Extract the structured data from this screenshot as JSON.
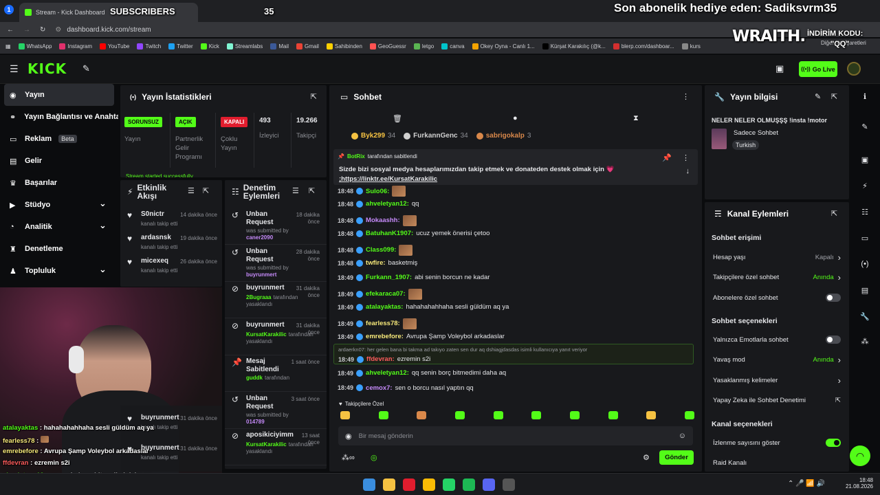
{
  "browser": {
    "tab_title": "Stream - Kick Dashboard",
    "url": "dashboard.kick.com/stream",
    "bookmarks": [
      "WhatsApp",
      "Instagram",
      "YouTube",
      "Twitch",
      "Twitter",
      "Kick",
      "Streamlabs",
      "Mail",
      "Gmail",
      "Sahibinden",
      "GeoGuessr",
      "letgo",
      "canva",
      "Okey Oyna - Canlı 1...",
      "Kürşat Karakılıç (@k...",
      "blerp.com/dashboar...",
      "kurs"
    ],
    "other_bookmarks": "Diğer Yer İşaretleri"
  },
  "overlay": {
    "subscribers_label": "SUBSCRIBERS",
    "subscribers_count": "35",
    "last_gift": "Son abonelik hediye eden: Sadiksvrm35",
    "sponsor": "WRAITH.",
    "discount_label": "İNDİRİM KODU:",
    "discount_code": "\"QQ\""
  },
  "topnav": {
    "go_live": "Go Live"
  },
  "sidebar": {
    "items": [
      {
        "label": "Yayın",
        "icon": "broadcast-icon"
      },
      {
        "label": "Yayın Bağlantısı ve Anahtarı",
        "icon": "link-icon"
      },
      {
        "label": "Reklam",
        "icon": "ad-icon",
        "badge": "Beta"
      },
      {
        "label": "Gelir",
        "icon": "wallet-icon"
      },
      {
        "label": "Başarılar",
        "icon": "trophy-icon"
      },
      {
        "label": "Stüdyo",
        "icon": "studio-icon"
      },
      {
        "label": "Analitik",
        "icon": "chart-icon"
      },
      {
        "label": "Denetleme",
        "icon": "shield-icon"
      },
      {
        "label": "Topluluk",
        "icon": "community-icon"
      }
    ]
  },
  "stats": {
    "title": "Yayın İstatistikleri",
    "items": [
      {
        "badge": "SORUNSUZ",
        "label": "Yayın"
      },
      {
        "badge": "AÇIK",
        "label": "Partnerlik Gelir Programı"
      },
      {
        "badge": "KAPALI",
        "label": "Çoklu Yayın"
      },
      {
        "value": "493",
        "label": "İzleyici"
      },
      {
        "value": "19.266",
        "label": "Takipçi"
      }
    ],
    "status_msg": "Stream started successfully"
  },
  "activity": {
    "title": "Etkinlik Akışı",
    "items": [
      {
        "user": "S0nictr",
        "action": "kanalı takip etti",
        "time": "14 dakika önce"
      },
      {
        "user": "ardasnsk",
        "action": "kanalı takip etti",
        "time": "19 dakika önce"
      },
      {
        "user": "micexeq",
        "action": "kanalı takip etti",
        "time": "26 dakika önce"
      },
      {
        "user": "buyrunmert",
        "action": "kanalı takip etti",
        "time": "31 dakika önce"
      },
      {
        "user": "buyrunmert",
        "action": "kanalı takip etti",
        "time": "31 dakika önce"
      }
    ]
  },
  "moderation": {
    "title": "Denetim Eylemleri",
    "items": [
      {
        "title": "Unban Request",
        "sub": "was submitted by",
        "who": "caner2090",
        "time": "18 dakika önce"
      },
      {
        "title": "Unban Request",
        "sub": "was submitted by",
        "who": "buyrunmert",
        "time": "28 dakika önce"
      },
      {
        "title": "buyrunmert",
        "who": "2Bugraaa",
        "sub": "tarafından yasaklandı",
        "time": "31 dakika önce"
      },
      {
        "title": "buyrunmert",
        "who": "KursatKarakilic",
        "sub": "tarafından yasaklandı",
        "time": "31 dakika önce"
      },
      {
        "title": "Mesaj Sabitlendi",
        "who": "guddk",
        "sub": "tarafından",
        "time": "1 saat önce"
      },
      {
        "title": "Unban Request",
        "sub": "was submitted by",
        "who": "014789",
        "time": "3 saat önce"
      },
      {
        "title": "aposikiciyimm",
        "who": "KursatKarakilic",
        "sub": "tarafından yasaklandı",
        "time": "13 saat önce"
      }
    ]
  },
  "chat": {
    "title": "Sohbet",
    "top_gifters": [
      {
        "name": "Byk299",
        "count": "34"
      },
      {
        "name": "FurkannGenc",
        "count": "34"
      },
      {
        "name": "sabrigokalp",
        "count": "3"
      }
    ],
    "pinned": {
      "user": "BotRix",
      "note": "tarafından sabitlendi",
      "text": "Sizde bizi sosyal medya hesaplarımızdan takip etmek ve donateden destek olmak için 💗",
      "link": ";https://linktr.ee/KursatKarakilic"
    },
    "messages": [
      {
        "t": "18:48",
        "user": "Sulo06:",
        "color": "#53fc18",
        "text": "",
        "emote": true
      },
      {
        "t": "18:48",
        "user": "ahveletyan12:",
        "color": "#53fc18",
        "text": "qq"
      },
      {
        "t": "18:48",
        "user": "Mokaashh:",
        "color": "#c58af9",
        "text": "",
        "emote": true
      },
      {
        "t": "18:48",
        "user": "BatuhanK1907:",
        "color": "#53fc18",
        "text": "ucuz yemek önerisi çetoo"
      },
      {
        "t": "18:48",
        "user": "Class099:",
        "color": "#53fc18",
        "text": "",
        "emote": true
      },
      {
        "t": "18:48",
        "user": "twfire:",
        "color": "#f7e97a",
        "text": "basketmiş"
      },
      {
        "t": "18:49",
        "user": "Furkann_1907:",
        "color": "#53fc18",
        "text": "abi senin borcun ne kadar"
      },
      {
        "t": "18:49",
        "user": "efekaraca07:",
        "color": "#53fc18",
        "text": "",
        "emote": true
      },
      {
        "t": "18:49",
        "user": "atalayaktas:",
        "color": "#53fc18",
        "text": "hahahahahhaha sesli güldüm aq ya"
      },
      {
        "t": "18:49",
        "user": "fearless78:",
        "color": "#f7e97a",
        "text": "",
        "emote": true
      },
      {
        "t": "18:49",
        "user": "emrebefore:",
        "color": "#f7e97a",
        "text": "Avrupa Şamp Voleybol arkadaslar"
      }
    ],
    "reply": {
      "context": "ardaerkn07: her gelen bana bi takma ad takıyo zaten sen dur aq dshiagjdasdas isimli kullanıcıya yanıt veriyor",
      "t": "18:49",
      "user": "ffdevran:",
      "text": "ezremin s2i"
    },
    "messages2": [
      {
        "t": "18:49",
        "user": "ahveletyan12:",
        "color": "#53fc18",
        "text": "qq senin borç bitmedimi daha aq"
      },
      {
        "t": "18:49",
        "user": "cemox7:",
        "color": "#c58af9",
        "text": "sen o borcu nasıl yaptın qq"
      }
    ],
    "followers_only": "Takipçilere Özel",
    "input_placeholder": "Bir mesaj gönderin",
    "send": "Gönder"
  },
  "info": {
    "title": "Yayın bilgisi",
    "stream_title": "NELER NELER OLMUŞŞŞ !insta !motor",
    "category": "Sadece Sohbet",
    "language": "Turkish"
  },
  "actions": {
    "title": "Kanal Eylemleri",
    "chat_access": "Sohbet erişimi",
    "rows1": [
      {
        "label": "Hesap yaşı",
        "value": "Kapalı",
        "type": "chevron"
      },
      {
        "label": "Takipçilere özel sohbet",
        "value": "Anında",
        "type": "chevron",
        "green": true
      },
      {
        "label": "Abonelere özel sohbet",
        "type": "toggle",
        "on": false
      }
    ],
    "chat_options": "Sohbet seçenekleri",
    "rows2": [
      {
        "label": "Yalnızca Emotlarla sohbet",
        "type": "toggle",
        "on": false
      },
      {
        "label": "Yavaş mod",
        "value": "Anında",
        "type": "chevron",
        "green": true
      },
      {
        "label": "Yasaklanmış kelimeler",
        "type": "chevron"
      },
      {
        "label": "Yapay Zeka ile Sohbet Denetimi",
        "type": "ext"
      }
    ],
    "channel_options": "Kanal seçenekleri",
    "rows3": [
      {
        "label": "İzlenme sayısını göster",
        "type": "toggle",
        "on": true
      },
      {
        "label": "Raid Kanalı",
        "type": "none"
      }
    ]
  },
  "overlay_chat": [
    {
      "user": "atalayaktas",
      "text": "hahahahahhaha sesli güldüm aq ya",
      "color": "#53fc18"
    },
    {
      "user": "fearless78",
      "text": "",
      "color": "#f7e97a"
    },
    {
      "user": "emrebefore",
      "text": "Avrupa Şamp Voleybol arkadaslar",
      "color": "#f7e97a"
    },
    {
      "user": "ffdevran",
      "text": "ezremin s2i",
      "color": "#ff5c5c"
    },
    {
      "user": "ahveletyan12",
      "text": "qq senin borç bitmedimi daha aq",
      "color": "#53fc18"
    },
    {
      "user": "cemox7",
      "text": "sen o borcu nasıl yaptın qq",
      "color": "#c58af9"
    }
  ],
  "taskbar": {
    "time": "18:48",
    "date": "21.08.2026"
  }
}
